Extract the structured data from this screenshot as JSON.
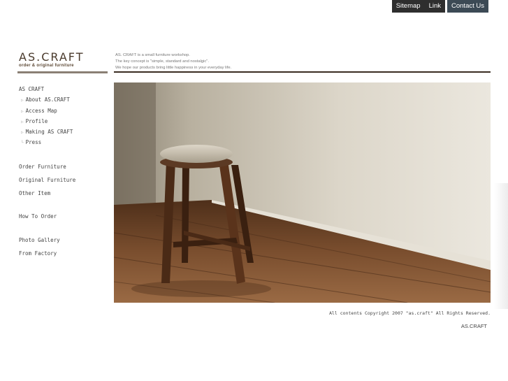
{
  "top_nav": {
    "sitemap": "Sitemap",
    "link": "Link",
    "contact": "Contact Us"
  },
  "logo": {
    "name": "AS.CRAFT",
    "sub": "order & original furniture"
  },
  "tagline": [
    "AS. CRAFT is a small furniture workshop.",
    "The key concept is \"simple, standard and nostalgic\".",
    "We hope our products bring little happiness in your everyday life."
  ],
  "sidebar": {
    "home": "AS CRAFT",
    "sub_items": [
      "About AS.CRAFT",
      "Access Map",
      "Profile",
      "Making AS CRAFT",
      "Press"
    ],
    "group1": [
      "Order Furniture",
      "Original Furniture",
      "Other Item"
    ],
    "group2": [
      "How To Order"
    ],
    "group3": [
      "Photo Gallery",
      "From Factory"
    ]
  },
  "footer": {
    "copyright": "All contents Copyright 2007  \"as.craft\" All Rights Reserved.",
    "brand": "AS.CRAFT"
  }
}
